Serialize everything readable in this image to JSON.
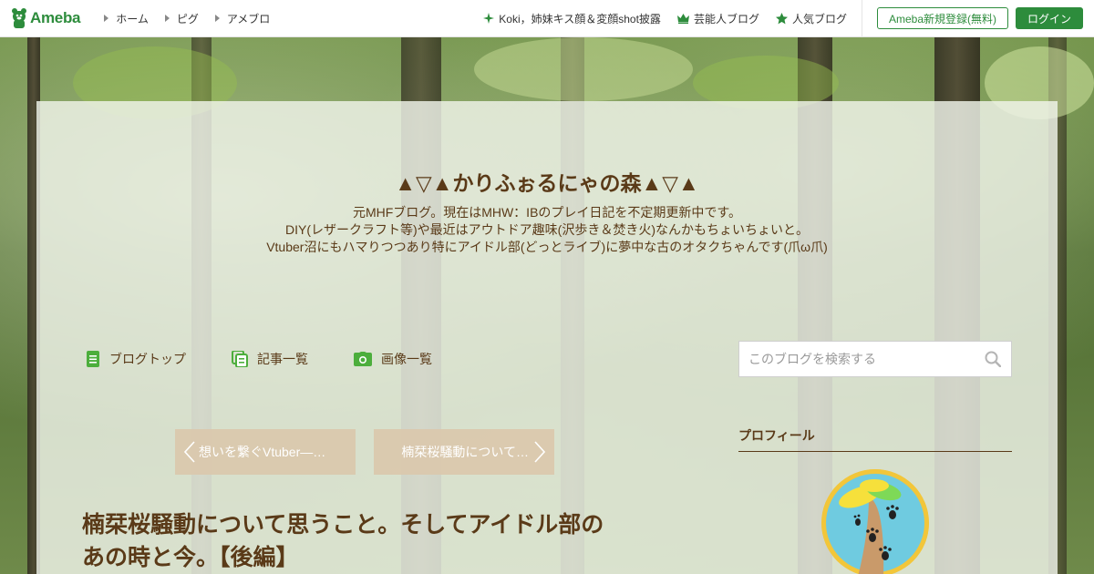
{
  "header": {
    "logo_text": "Ameba",
    "nav": [
      "ホーム",
      "ピグ",
      "アメブロ"
    ],
    "links": [
      {
        "icon": "sparkle-icon",
        "label": "Koki，姉妹キス顔＆変顔shot披露"
      },
      {
        "icon": "crown-icon",
        "label": "芸能人ブログ"
      },
      {
        "icon": "star-icon",
        "label": "人気ブログ"
      }
    ],
    "register_label": "Ameba新規登録(無料)",
    "login_label": "ログイン"
  },
  "blog": {
    "title": "▲▽▲かりふぉるにゃの森▲▽▲",
    "description": [
      "元MHFブログ。現在はMHW：IBのプレイ日記を不定期更新中です。",
      "DIY(レザークラフト等)や最近はアウトドア趣味(沢歩き＆焚き火)なんかもちょいちょいと。",
      "Vtuber沼にもハマりつつあり特にアイドル部(どっとライブ)に夢中な古のオタクちゃんです(爪ω爪)"
    ]
  },
  "blog_nav": {
    "top": "ブログトップ",
    "entries": "記事一覧",
    "images": "画像一覧"
  },
  "search": {
    "placeholder": "このブログを検索する"
  },
  "pager": {
    "prev": "想いを繋ぐVtuber—…",
    "next": "楠栞桜騒動について…"
  },
  "article": {
    "title_line1": "楠栞桜騒動について思うこと。そしてアイドル部の",
    "title_line2": "あの時と今。【後編】"
  },
  "sidebar": {
    "profile_heading": "プロフィール"
  },
  "colors": {
    "brand": "#2d8c3c",
    "text_brown": "#5a3a18",
    "pager_bg": "#dac8ac"
  }
}
